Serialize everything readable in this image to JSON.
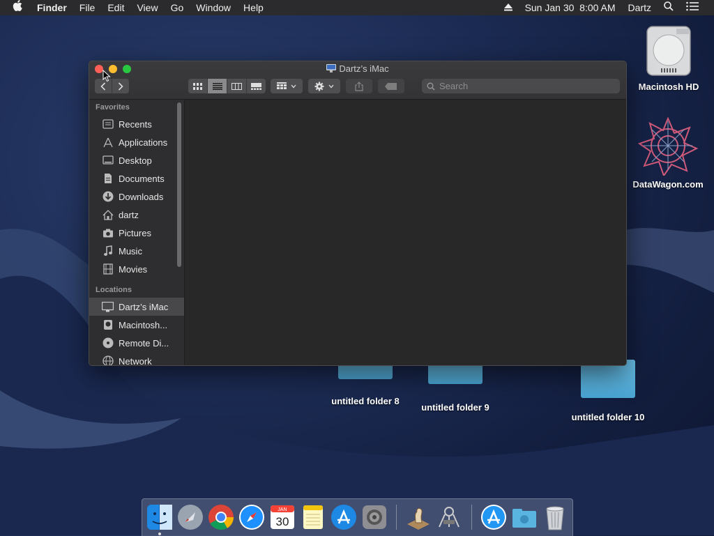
{
  "menubar": {
    "apple": "",
    "app_name": "Finder",
    "menus": [
      "File",
      "Edit",
      "View",
      "Go",
      "Window",
      "Help"
    ],
    "date_time": "Sun Jan 30  8:00 AM",
    "user": "Dartz"
  },
  "desktop": {
    "items": [
      {
        "label": "Macintosh HD"
      },
      {
        "label": "DataWagon.com"
      },
      {
        "label": "untitled folder 8"
      },
      {
        "label": "untitled folder 9"
      },
      {
        "label": "untitled folder 10"
      }
    ]
  },
  "window": {
    "title": "Dartz’s iMac",
    "search_placeholder": "Search",
    "sidebar": {
      "favorites_heading": "Favorites",
      "favorites": [
        {
          "label": "Recents",
          "icon": "recents-icon"
        },
        {
          "label": "Applications",
          "icon": "applications-icon"
        },
        {
          "label": "Desktop",
          "icon": "desktop-icon"
        },
        {
          "label": "Documents",
          "icon": "documents-icon"
        },
        {
          "label": "Downloads",
          "icon": "downloads-icon"
        },
        {
          "label": "dartz",
          "icon": "home-icon"
        },
        {
          "label": "Pictures",
          "icon": "pictures-icon"
        },
        {
          "label": "Music",
          "icon": "music-icon"
        },
        {
          "label": "Movies",
          "icon": "movies-icon"
        }
      ],
      "locations_heading": "Locations",
      "locations": [
        {
          "label": "Dartz’s iMac",
          "icon": "imac-icon",
          "selected": true
        },
        {
          "label": "Macintosh...",
          "icon": "disk-icon"
        },
        {
          "label": "Remote Di...",
          "icon": "remote-disc-icon"
        },
        {
          "label": "Network",
          "icon": "network-icon"
        }
      ]
    }
  },
  "dock": {
    "apps": [
      "Finder",
      "Launchpad",
      "Chrome",
      "Safari",
      "Calendar",
      "Notes",
      "App Store",
      "System Preferences",
      "Chess",
      "Automator",
      "App Store Downloads",
      "Downloads Folder",
      "Trash"
    ],
    "calendar_month": "JAN",
    "calendar_day": "30"
  },
  "colors": {
    "menubar": "#2b2b2d",
    "window_bg": "#282828",
    "sidebar_bg": "#2e2e30",
    "close": "#ff5f57",
    "minimize": "#febc2e",
    "zoom": "#28c840",
    "folder": "#5ab4e0"
  }
}
